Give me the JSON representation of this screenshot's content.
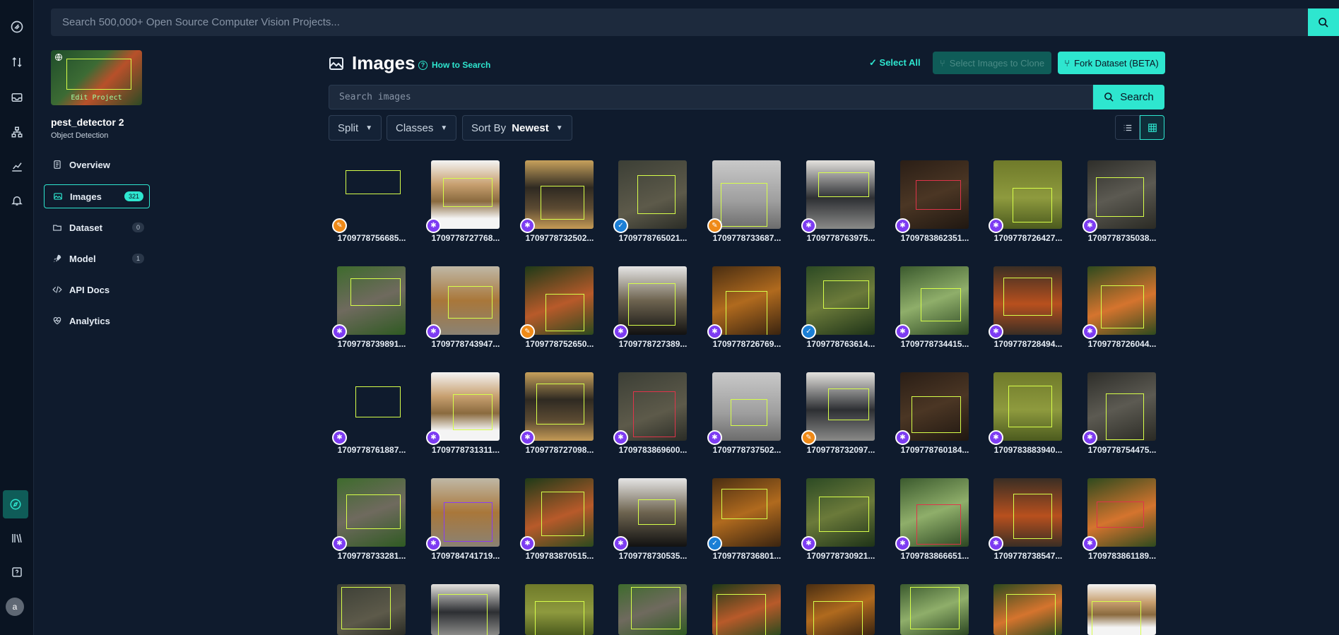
{
  "topbar": {
    "search_placeholder": "Search 500,000+ Open Source Computer Vision Projects..."
  },
  "project": {
    "name": "pest_detector 2",
    "type": "Object Detection",
    "edit_label": "Edit Project"
  },
  "nav": [
    {
      "label": "Overview",
      "icon": "overview-icon"
    },
    {
      "label": "Images",
      "icon": "images-icon",
      "count": "321",
      "active": true
    },
    {
      "label": "Dataset",
      "icon": "dataset-icon",
      "count": "0"
    },
    {
      "label": "Model",
      "icon": "rocket-icon",
      "count": "1"
    },
    {
      "label": "API Docs",
      "icon": "code-icon"
    },
    {
      "label": "Analytics",
      "icon": "analytics-icon"
    }
  ],
  "header": {
    "title": "Images",
    "how_to_search": "How to Search",
    "select_all": "Select All",
    "select_to_clone": "Select Images to Clone",
    "fork_dataset": "Fork Dataset (BETA)"
  },
  "image_search": {
    "placeholder": "Search images",
    "button": "Search"
  },
  "filters": {
    "split": "Split",
    "classes": "Classes",
    "sort_label": "Sort By",
    "sort_value": "Newest"
  },
  "colors": {
    "accent": "#2ee6cf",
    "background": "#0f1b2d",
    "badge_purple": "#7d3cf2",
    "badge_orange": "#ef8a18",
    "badge_blue": "#1b7fd6"
  },
  "rows": [
    [
      {
        "name": "1709778756685...",
        "badge": "orange"
      },
      {
        "name": "1709778727768...",
        "badge": "purple"
      },
      {
        "name": "1709778732502...",
        "badge": "purple"
      },
      {
        "name": "1709778765021...",
        "badge": "blue"
      },
      {
        "name": "1709778733687...",
        "badge": "orange"
      },
      {
        "name": "1709778763975...",
        "badge": "purple"
      },
      {
        "name": "1709783862351...",
        "badge": "purple"
      },
      {
        "name": "1709778726427...",
        "badge": "purple"
      },
      {
        "name": "1709778735038...",
        "badge": "purple"
      }
    ],
    [
      {
        "name": "1709778739891...",
        "badge": "purple"
      },
      {
        "name": "1709778743947...",
        "badge": "purple"
      },
      {
        "name": "1709778752650...",
        "badge": "orange"
      },
      {
        "name": "1709778727389...",
        "badge": "purple"
      },
      {
        "name": "1709778726769...",
        "badge": "purple"
      },
      {
        "name": "1709778763614...",
        "badge": "blue"
      },
      {
        "name": "1709778734415...",
        "badge": "purple"
      },
      {
        "name": "1709778728494...",
        "badge": "purple"
      },
      {
        "name": "1709778726044...",
        "badge": "purple"
      }
    ],
    [
      {
        "name": "1709778761887...",
        "badge": "purple"
      },
      {
        "name": "1709778731311...",
        "badge": "purple"
      },
      {
        "name": "1709778727098...",
        "badge": "purple"
      },
      {
        "name": "1709783869600...",
        "badge": "purple"
      },
      {
        "name": "1709778737502...",
        "badge": "purple"
      },
      {
        "name": "1709778732097...",
        "badge": "orange"
      },
      {
        "name": "1709778760184...",
        "badge": "purple"
      },
      {
        "name": "1709783883940...",
        "badge": "purple"
      },
      {
        "name": "1709778754475...",
        "badge": "purple"
      }
    ],
    [
      {
        "name": "1709778733281...",
        "badge": "purple"
      },
      {
        "name": "1709784741719...",
        "badge": "purple"
      },
      {
        "name": "1709783870515...",
        "badge": "purple"
      },
      {
        "name": "1709778730535...",
        "badge": "purple"
      },
      {
        "name": "1709778736801...",
        "badge": "blue"
      },
      {
        "name": "1709778730921...",
        "badge": "purple"
      },
      {
        "name": "1709783866651...",
        "badge": "purple"
      },
      {
        "name": "1709778738547...",
        "badge": "purple"
      },
      {
        "name": "1709783861189...",
        "badge": "purple"
      }
    ]
  ]
}
